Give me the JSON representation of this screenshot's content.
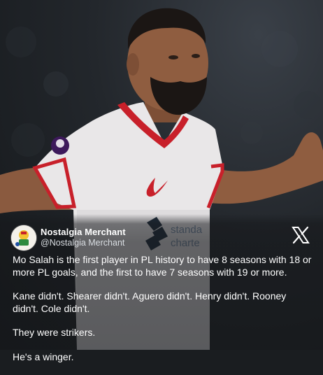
{
  "post": {
    "author_name": "Nostalgia Merchant",
    "author_handle": "@Nostalgia Merchant",
    "platform_icon": "x-logo-icon",
    "paragraphs": [
      "Mo Salah is the first player in PL history to have 8 seasons with 18 or more PL goals, and the first to have 7 seasons with 19 or more.",
      "Kane didn't. Shearer didn't. Aguero didn't. Henry didn't. Rooney didn't. Cole didn't.",
      "They were strikers.",
      "He's a winger."
    ]
  },
  "photo": {
    "shirt_sponsor_text": "standa\nchartе",
    "shirt_sponsor_line1": "standa",
    "shirt_sponsor_line2": "charte"
  },
  "colors": {
    "shirt": "#e9e7e8",
    "trim": "#c8202a",
    "overlay": "#16181b",
    "text": "#ffffff"
  }
}
